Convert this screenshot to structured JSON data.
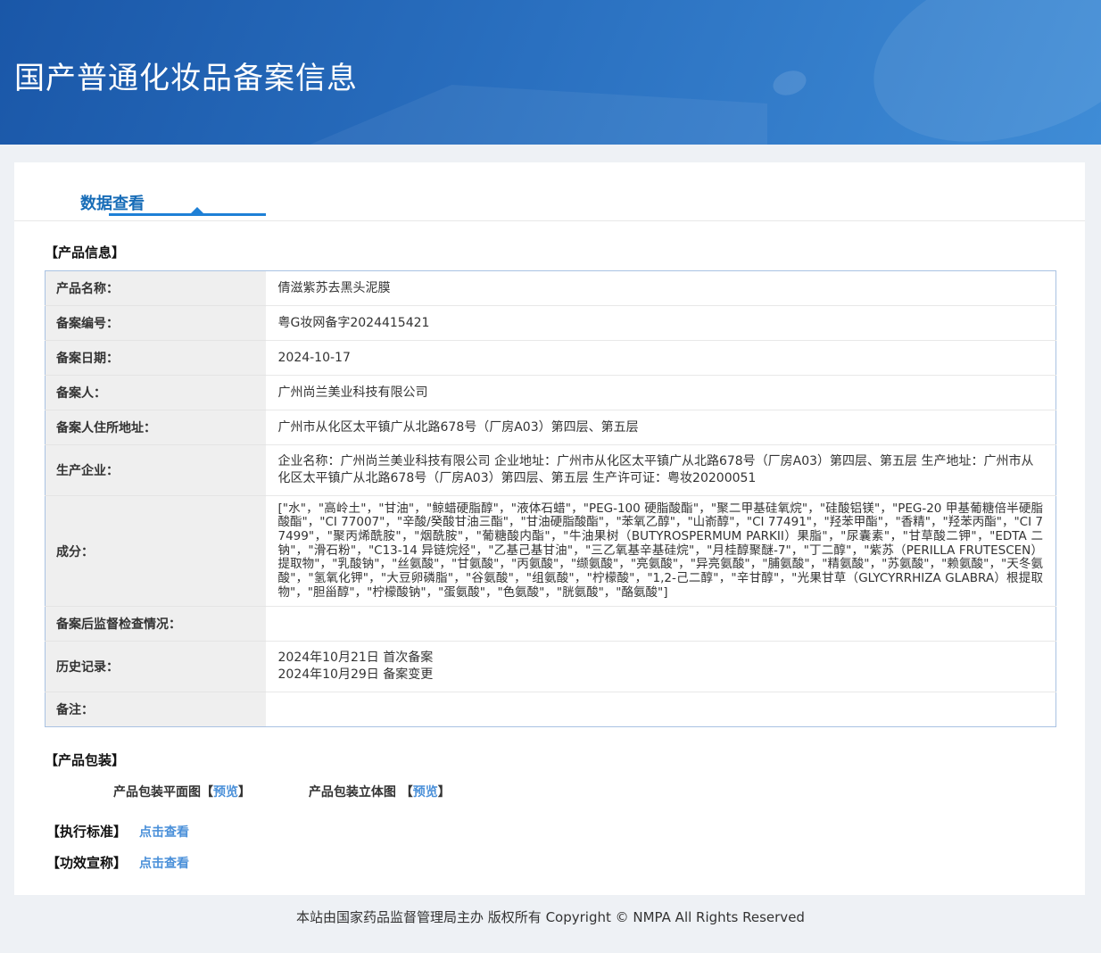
{
  "header": {
    "title": "国产普通化妆品备案信息"
  },
  "tab": {
    "label": "数据查看"
  },
  "product_info": {
    "section_title": "【产品信息】",
    "rows": [
      {
        "label": "产品名称：",
        "value": "倩滋紫苏去黑头泥膜"
      },
      {
        "label": "备案编号：",
        "value": "粤G妆网备字2024415421"
      },
      {
        "label": "备案日期：",
        "value": "2024-10-17"
      },
      {
        "label": "备案人：",
        "value": "广州尚兰美业科技有限公司"
      },
      {
        "label": "备案人住所地址：",
        "value": "广州市从化区太平镇广从北路678号（厂房A03）第四层、第五层"
      },
      {
        "label": "生产企业：",
        "value": "企业名称：广州尚兰美业科技有限公司 企业地址：广州市从化区太平镇广从北路678号（厂房A03）第四层、第五层 生产地址：广州市从化区太平镇广从北路678号（厂房A03）第四层、第五层 生产许可证：粤妆20200051"
      },
      {
        "label": "成分：",
        "value": "[\"水\"，\"高岭土\"，\"甘油\"，\"鲸蜡硬脂醇\"，\"液体石蜡\"，\"PEG-100 硬脂酸酯\"，\"聚二甲基硅氧烷\"，\"硅酸铝镁\"，\"PEG-20 甲基葡糖倍半硬脂酸酯\"，\"CI 77007\"，\"辛酸/癸酸甘油三酯\"，\"甘油硬脂酸酯\"，\"苯氧乙醇\"，\"山嵛醇\"，\"CI 77491\"，\"羟苯甲酯\"，\"香精\"，\"羟苯丙酯\"，\"CI 77499\"，\"聚丙烯酰胺\"，\"烟酰胺\"，\"葡糖酸内酯\"，\"牛油果树（BUTYROSPERMUM PARKII）果脂\"，\"尿囊素\"，\"甘草酸二钾\"，\"EDTA 二钠\"，\"滑石粉\"，\"C13-14 异链烷烃\"，\"乙基己基甘油\"，\"三乙氧基辛基硅烷\"，\"月桂醇聚醚-7\"，\"丁二醇\"，\"紫苏（PERILLA FRUTESCEN）提取物\"，\"乳酸钠\"，\"丝氨酸\"，\"甘氨酸\"，\"丙氨酸\"，\"缬氨酸\"，\"亮氨酸\"，\"异亮氨酸\"，\"脯氨酸\"，\"精氨酸\"，\"苏氨酸\"，\"赖氨酸\"，\"天冬氨酸\"，\"氢氧化钾\"，\"大豆卵磷脂\"，\"谷氨酸\"，\"组氨酸\"，\"柠檬酸\"，\"1,2-己二醇\"，\"辛甘醇\"，\"光果甘草（GLYCYRRHIZA GLABRA）根提取物\"，\"胆甾醇\"，\"柠檬酸钠\"，\"蛋氨酸\"，\"色氨酸\"，\"胱氨酸\"，\"酪氨酸\"]"
      },
      {
        "label": "备案后监督检查情况：",
        "value": ""
      },
      {
        "label": "历史记录：",
        "value": "2024年10月21日 首次备案\n2024年10月29日 备案变更"
      },
      {
        "label": "备注：",
        "value": ""
      }
    ]
  },
  "packaging": {
    "section_title": "【产品包装】",
    "bracket_open": "【",
    "bracket_close": "】",
    "items": [
      {
        "label": "产品包装平面图",
        "link": "预览"
      },
      {
        "label": "产品包装立体图 ",
        "link": "预览"
      }
    ]
  },
  "standards": {
    "execution": {
      "title": "【执行标准】",
      "link": "点击查看"
    },
    "efficacy": {
      "title": "【功效宣称】",
      "link": "点击查看"
    }
  },
  "footer": {
    "text": "本站由国家药品监督管理局主办 版权所有 Copyright © NMPA All Rights Reserved"
  },
  "colors": {
    "header_gradient_start": "#1a57a8",
    "header_gradient_end": "#3f8cd6",
    "tab_blue": "#176cb7",
    "underline_blue": "#1e80d6",
    "link_blue": "#4a90d9",
    "table_border": "#a9c2e2",
    "label_cell_bg": "#efefef",
    "page_bg": "#eef1f5"
  }
}
